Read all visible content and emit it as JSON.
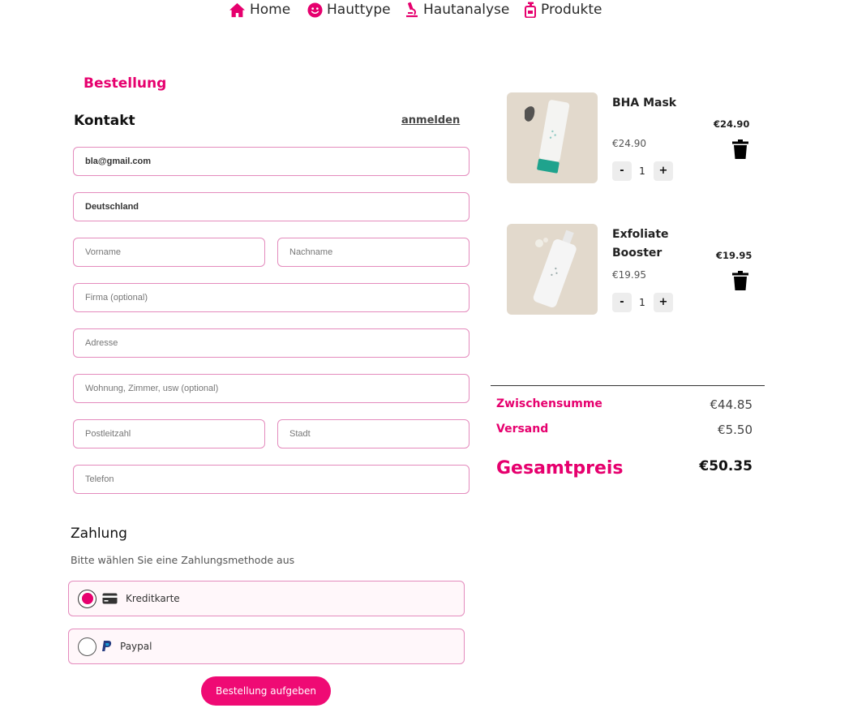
{
  "nav": {
    "home": "Home",
    "skin_type": "Hauttype",
    "skin_analysis": "Hautanalyse",
    "products": "Produkte"
  },
  "order": {
    "title": "Bestellung",
    "contact_title": "Kontakt",
    "login_link": "anmelden"
  },
  "form": {
    "email_value": "bla@gmail.com",
    "country_value": "Deutschland",
    "first_name_placeholder": "Vorname",
    "last_name_placeholder": "Nachname",
    "company_placeholder": "Firma (optional)",
    "address_placeholder": "Adresse",
    "apartment_placeholder": "Wohnung, Zimmer, usw (optional)",
    "zip_placeholder": "Postleitzahl",
    "city_placeholder": "Stadt",
    "phone_placeholder": "Telefon"
  },
  "payment": {
    "title": "Zahlung",
    "subtitle": "Bitte wählen Sie eine Zahlungsmethode aus",
    "options": [
      {
        "label": "Kreditkarte",
        "icon": "credit-card-icon",
        "selected": true
      },
      {
        "label": "Paypal",
        "icon": "paypal-icon",
        "selected": false
      }
    ],
    "submit_label": "Bestellung aufgeben"
  },
  "cart": {
    "items": [
      {
        "name": "BHA Mask",
        "unit_price": "€24.90",
        "line_total": "€24.90",
        "quantity": "1",
        "minus": "-",
        "plus": "+"
      },
      {
        "name": "Exfoliate Booster",
        "unit_price": "€19.95",
        "line_total": "€19.95",
        "quantity": "1",
        "minus": "-",
        "plus": "+"
      }
    ],
    "subtotal_label": "Zwischensumme",
    "subtotal_value": "€44.85",
    "shipping_label": "Versand",
    "shipping_value": "€5.50",
    "total_label": "Gesamtpreis",
    "total_value": "€50.35"
  },
  "colors": {
    "accent": "#e6006e",
    "field_border": "#e48bbd",
    "product_bg": "#e2d9cc"
  }
}
